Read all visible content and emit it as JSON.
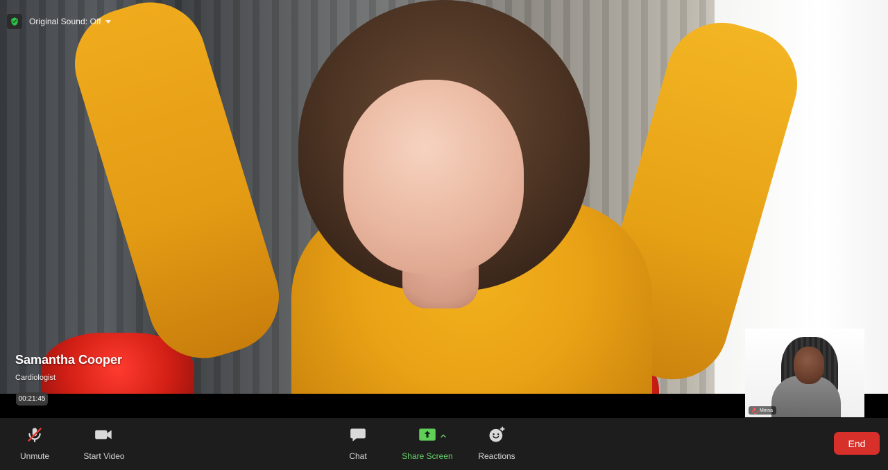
{
  "header": {
    "original_sound_label": "Original Sound: Off"
  },
  "main_participant": {
    "name": "Samantha Cooper",
    "role": "Cardiologist",
    "elapsed": "00:21:45"
  },
  "self_view": {
    "name": "Minna"
  },
  "controls": {
    "unmute_label": "Unmute",
    "start_video_label": "Start Video",
    "chat_label": "Chat",
    "share_screen_label": "Share Screen",
    "reactions_label": "Reactions",
    "end_label": "End"
  },
  "icons": {
    "shield": "shield-icon",
    "mic_muted": "mic-muted-icon",
    "video": "video-icon",
    "chat": "chat-icon",
    "share": "share-screen-icon",
    "caret_up": "caret-up-icon",
    "reactions": "reactions-icon"
  },
  "colors": {
    "accent_green": "#68d169",
    "end_red": "#d72f2a",
    "controls_bg": "#1d1d1d"
  }
}
